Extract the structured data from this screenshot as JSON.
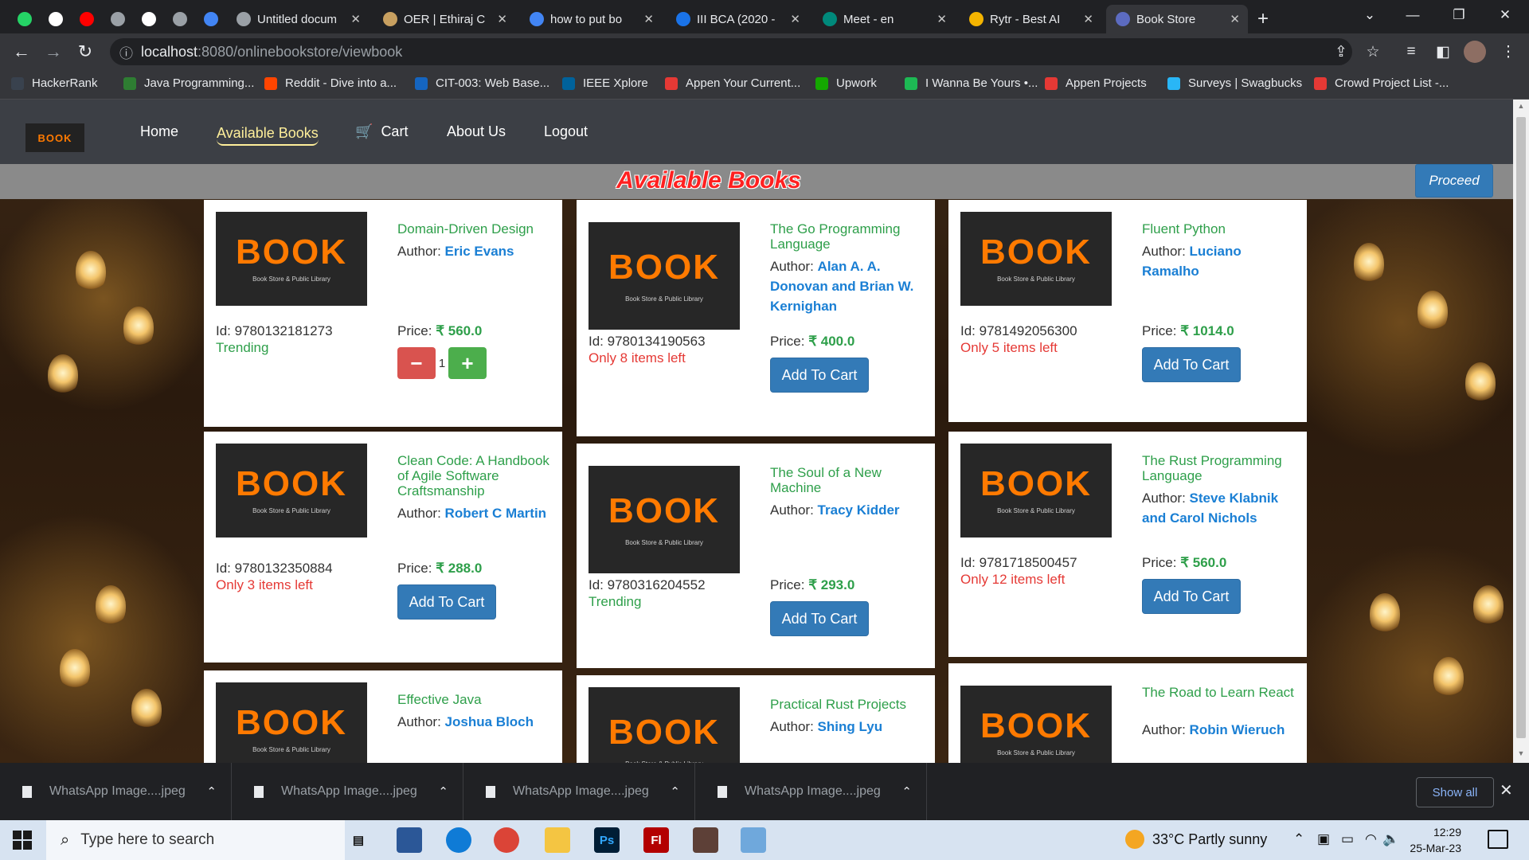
{
  "browser": {
    "tabs": [
      {
        "title": "",
        "color": "#25d366",
        "icon": "whatsapp-icon",
        "pinned": true
      },
      {
        "title": "",
        "color": "#ffffff",
        "icon": "github-icon",
        "pinned": true
      },
      {
        "title": "",
        "color": "#ff0000",
        "icon": "youtube-icon",
        "pinned": true
      },
      {
        "title": "",
        "color": "#9aa0a6",
        "icon": "globe-icon",
        "pinned": true
      },
      {
        "title": "",
        "color": "#ffffff",
        "icon": "a-icon",
        "pinned": true
      },
      {
        "title": "",
        "color": "#9aa0a6",
        "icon": "globe-icon",
        "pinned": true
      },
      {
        "title": "",
        "color": "#4285f4",
        "icon": "docs-icon",
        "pinned": true
      },
      {
        "title": "Untitled docum",
        "color": "#9aa0a6",
        "icon": "globe-icon",
        "pinned": false
      },
      {
        "title": "OER | Ethiraj C",
        "color": "#c8a060",
        "icon": "oer-icon",
        "pinned": false
      },
      {
        "title": "how to put bo",
        "color": "#4285f4",
        "icon": "google-icon",
        "pinned": false
      },
      {
        "title": "III BCA (2020 -",
        "color": "#1a73e8",
        "icon": "classroom-icon",
        "pinned": false
      },
      {
        "title": "Meet - en",
        "color": "#00897b",
        "icon": "meet-icon",
        "pinned": false
      },
      {
        "title": "Rytr - Best AI",
        "color": "#f4b400",
        "icon": "rytr-icon",
        "pinned": false
      },
      {
        "title": "Book Store",
        "color": "#5c6bc0",
        "icon": "bookstore-icon",
        "pinned": false,
        "active": true
      }
    ],
    "new_tab_label": "+",
    "url_host": "localhost",
    "url_path": ":8080/onlinebookstore/viewbook",
    "bookmarks": [
      {
        "label": "HackerRank",
        "color": "#39424e"
      },
      {
        "label": "Java Programming...",
        "color": "#2e7d32"
      },
      {
        "label": "Reddit - Dive into a...",
        "color": "#ff4500"
      },
      {
        "label": "CIT-003: Web Base...",
        "color": "#1565c0"
      },
      {
        "label": "IEEE Xplore",
        "color": "#00629b"
      },
      {
        "label": "Appen Your Current...",
        "color": "#e53935"
      },
      {
        "label": "Upwork",
        "color": "#14a800"
      },
      {
        "label": "I Wanna Be Yours •...",
        "color": "#1db954"
      },
      {
        "label": "Appen Projects",
        "color": "#e53935"
      },
      {
        "label": "Surveys | Swagbucks",
        "color": "#29b6f6"
      },
      {
        "label": "Crowd Project List -...",
        "color": "#e53935"
      }
    ]
  },
  "site": {
    "logo_text": "BOOK",
    "nav": {
      "home": "Home",
      "available_books": "Available Books",
      "cart": "Cart",
      "about": "About Us",
      "logout": "Logout"
    },
    "page_title": "Available Books",
    "proceed_label": "Proceed",
    "cover_text": "BOOK",
    "cover_subtitle": "Book Store & Public Library",
    "author_prefix": "Author:",
    "id_prefix": "Id:",
    "price_prefix": "Price:",
    "currency": "₹",
    "add_to_cart_label": "Add To Cart",
    "books": [
      {
        "title": "Domain-Driven Design",
        "author": "Eric Evans",
        "id": "9780132181273",
        "price": "560.0",
        "status": "Trending",
        "status_type": "trend",
        "in_cart": true,
        "quantity": "1"
      },
      {
        "title": "The Go Programming Language",
        "author": "Alan A. A. Donovan and Brian W. Kernighan",
        "id": "9780134190563",
        "price": "400.0",
        "status": "Only 8 items left",
        "status_type": "low",
        "in_cart": false
      },
      {
        "title": "Fluent Python",
        "author": "Luciano Ramalho",
        "id": "9781492056300",
        "price": "1014.0",
        "status": "Only 5 items left",
        "status_type": "low",
        "in_cart": false
      },
      {
        "title": "Clean Code: A Handbook of Agile Software Craftsmanship",
        "author": "Robert C Martin",
        "id": "9780132350884",
        "price": "288.0",
        "status": "Only 3 items left",
        "status_type": "low",
        "in_cart": false
      },
      {
        "title": "The Soul of a New Machine",
        "author": "Tracy Kidder",
        "id": "9780316204552",
        "price": "293.0",
        "status": "Trending",
        "status_type": "trend",
        "in_cart": false
      },
      {
        "title": "The Rust Programming Language",
        "author": "Steve Klabnik and Carol Nichols",
        "id": "9781718500457",
        "price": "560.0",
        "status": "Only 12 items left",
        "status_type": "low",
        "in_cart": false
      },
      {
        "title": "Effective Java",
        "author": "Joshua Bloch"
      },
      {
        "title": "Practical Rust Projects",
        "author": "Shing Lyu"
      },
      {
        "title": "The Road to Learn React",
        "author": "Robin Wieruch"
      }
    ]
  },
  "downloads": {
    "items": [
      "WhatsApp Image....jpeg",
      "WhatsApp Image....jpeg",
      "WhatsApp Image....jpeg",
      "WhatsApp Image....jpeg"
    ],
    "show_all_label": "Show all"
  },
  "taskbar": {
    "search_placeholder": "Type here to search",
    "weather": "33°C  Partly sunny",
    "time": "12:29",
    "date": "25-Mar-23",
    "apps": [
      {
        "icon": "task-view-icon",
        "color": "transparent",
        "label": ""
      },
      {
        "icon": "store-icon",
        "color": "#2b5797",
        "label": ""
      },
      {
        "icon": "edge-icon",
        "color": "#0f7bd6",
        "label": ""
      },
      {
        "icon": "chrome-icon",
        "color": "#db4437",
        "label": ""
      },
      {
        "icon": "file-explorer-icon",
        "color": "#f4c542",
        "label": ""
      },
      {
        "icon": "photoshop-icon",
        "color": "#001e36",
        "label": "Ps"
      },
      {
        "icon": "flash-icon",
        "color": "#b30000",
        "label": "Fl"
      },
      {
        "icon": "game-icon",
        "color": "#5d4037",
        "label": ""
      },
      {
        "icon": "photos-icon",
        "color": "#6fa8dc",
        "label": ""
      }
    ]
  }
}
